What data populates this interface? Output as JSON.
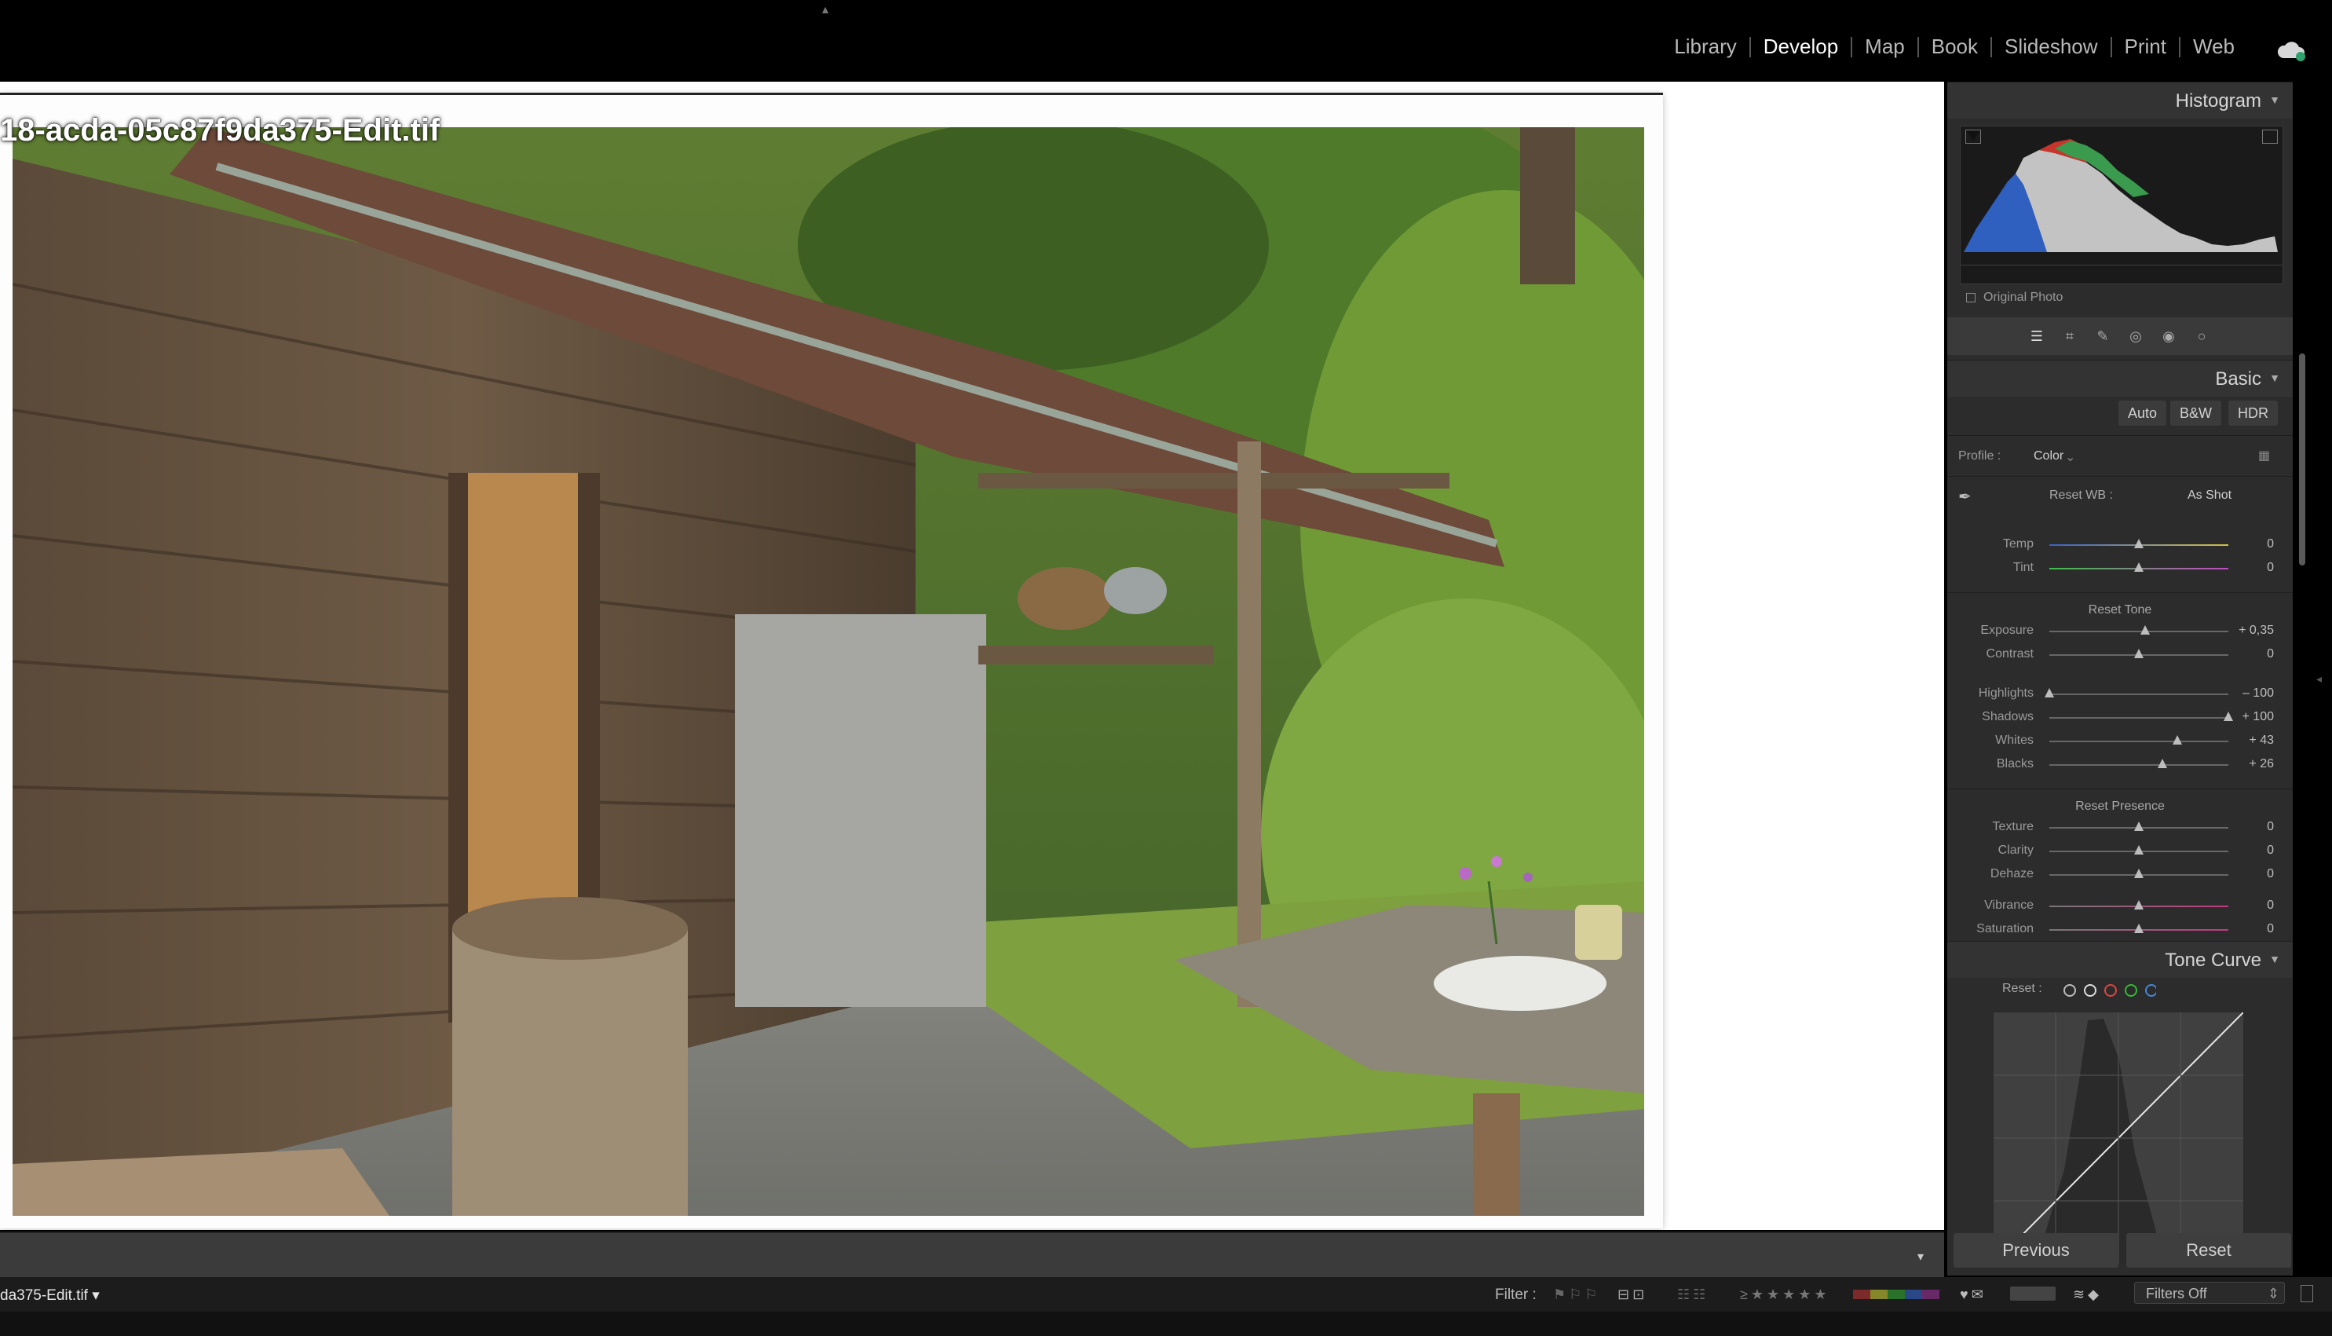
{
  "app": {
    "modules": [
      "Library",
      "Develop",
      "Map",
      "Book",
      "Slideshow",
      "Print",
      "Web"
    ],
    "active_module": "Develop"
  },
  "photo": {
    "filename_overlay": "18-acda-05c87f9da375-Edit.tif"
  },
  "filmstrip": {
    "filename": "da375-Edit.tif",
    "filter_label": "Filter :",
    "filters_value": "Filters Off"
  },
  "panels": {
    "histogram_title": "Histogram",
    "original_photo_label": "Original Photo",
    "basic_title": "Basic",
    "treatment_buttons": [
      "Auto",
      "B&W",
      "HDR"
    ],
    "profile_label": "Profile :",
    "profile_value": "Color",
    "reset_wb": "Reset WB :",
    "wb_value": "As Shot",
    "tone_curve_title": "Tone Curve",
    "tone_curve_reset": "Reset :"
  },
  "sliders": [
    {
      "label": "Temp",
      "value": "0",
      "pos": 0.5
    },
    {
      "label": "Tint",
      "value": "0",
      "pos": 0.5
    },
    {
      "section": "Reset Tone"
    },
    {
      "label": "Exposure",
      "value": "+ 0,35",
      "pos": 0.535
    },
    {
      "label": "Contrast",
      "value": "0",
      "pos": 0.5
    },
    {
      "label": "Highlights",
      "value": "– 100",
      "pos": 0.0
    },
    {
      "label": "Shadows",
      "value": "+ 100",
      "pos": 1.0
    },
    {
      "label": "Whites",
      "value": "+ 43",
      "pos": 0.715
    },
    {
      "label": "Blacks",
      "value": "+ 26",
      "pos": 0.63
    },
    {
      "section": "Reset Presence"
    },
    {
      "label": "Texture",
      "value": "0",
      "pos": 0.5
    },
    {
      "label": "Clarity",
      "value": "0",
      "pos": 0.5
    },
    {
      "label": "Dehaze",
      "value": "0",
      "pos": 0.5
    },
    {
      "label": "Vibrance",
      "value": "0",
      "pos": 0.5
    },
    {
      "label": "Saturation",
      "value": "0",
      "pos": 0.5
    }
  ],
  "footer_buttons": {
    "previous": "Previous",
    "reset": "Reset"
  }
}
